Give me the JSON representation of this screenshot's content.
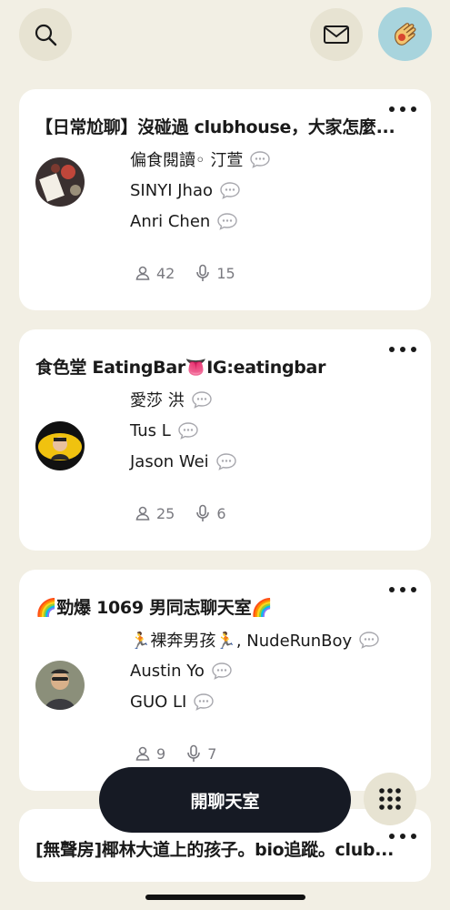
{
  "header": {
    "search_icon": "search-icon",
    "mail_icon": "mail-icon",
    "avatar_icon": "profile-avatar"
  },
  "rooms": [
    {
      "title": "【日常尬聊】沒碰過 clubhouse，大家怎麼...",
      "speakers": [
        "偏食閱讀◦ 汀萱",
        "SINYI Jhao",
        "Anri Chen"
      ],
      "listeners": "42",
      "speakers_count": "15"
    },
    {
      "title": "食色堂 EatingBar👅IG:eatingbar",
      "speakers": [
        "愛莎 洪",
        "Tus L",
        "Jason Wei"
      ],
      "listeners": "25",
      "speakers_count": "6"
    },
    {
      "title": "🌈勁爆 1069 男同志聊天室🌈",
      "speakers": [
        "🏃裸奔男孩🏃, NudeRunBoy",
        "Austin Yo",
        "GUO LI"
      ],
      "listeners": "9",
      "speakers_count": "7"
    },
    {
      "title": "[無聲房]椰林大道上的孩子。bio追蹤。club...",
      "speakers": [],
      "listeners": "",
      "speakers_count": ""
    }
  ],
  "start_room_label": "開聊天室",
  "colors": {
    "background": "#f2efe4",
    "card": "#ffffff",
    "button_dark": "#161a24",
    "circle_button": "#e7e3d2",
    "avatar_bg": "#a8d4dd",
    "muted": "#7a7a80"
  }
}
